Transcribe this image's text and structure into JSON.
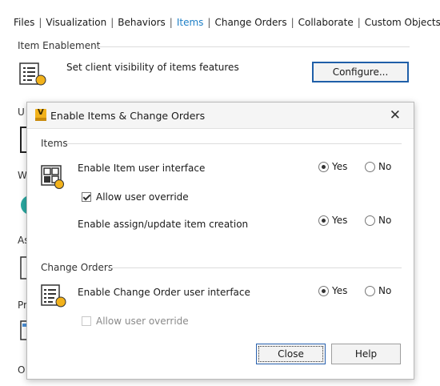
{
  "tabs": [
    {
      "label": "Files",
      "active": false
    },
    {
      "label": "Visualization",
      "active": false
    },
    {
      "label": "Behaviors",
      "active": false
    },
    {
      "label": "Items",
      "active": true
    },
    {
      "label": "Change Orders",
      "active": false
    },
    {
      "label": "Collaborate",
      "active": false
    },
    {
      "label": "Custom Objects",
      "active": false
    }
  ],
  "item_enablement": {
    "section_title": "Item Enablement",
    "description": "Set client visibility of items features",
    "configure_label": "Configure..."
  },
  "background_fragments": [
    "U",
    "W",
    "As",
    "Pr",
    "O"
  ],
  "dialog": {
    "app_icon_letter": "V",
    "title": "Enable Items & Change Orders",
    "items_group": {
      "title": "Items",
      "enable_ui_label": "Enable Item user interface",
      "enable_ui_yes": "Yes",
      "enable_ui_no": "No",
      "enable_ui_value": "Yes",
      "allow_override_label": "Allow user override",
      "allow_override_checked": true,
      "assign_label": "Enable assign/update item creation",
      "assign_yes": "Yes",
      "assign_no": "No",
      "assign_value": "Yes"
    },
    "change_orders_group": {
      "title": "Change Orders",
      "enable_ui_label": "Enable Change Order user interface",
      "enable_ui_yes": "Yes",
      "enable_ui_no": "No",
      "enable_ui_value": "Yes",
      "allow_override_label": "Allow user override",
      "allow_override_checked": false,
      "allow_override_enabled": false
    },
    "close_label": "Close",
    "help_label": "Help"
  },
  "colors": {
    "accent": "#1e7fc6",
    "icon_yellow": "#f2b21b",
    "focus_border": "#1f5fa8"
  },
  "icons": [
    "items-list-icon",
    "grid-items-icon",
    "change-order-list-icon",
    "vault-app-icon",
    "close-icon",
    "background-document-icon",
    "background-globe-icon",
    "background-table-icon"
  ]
}
